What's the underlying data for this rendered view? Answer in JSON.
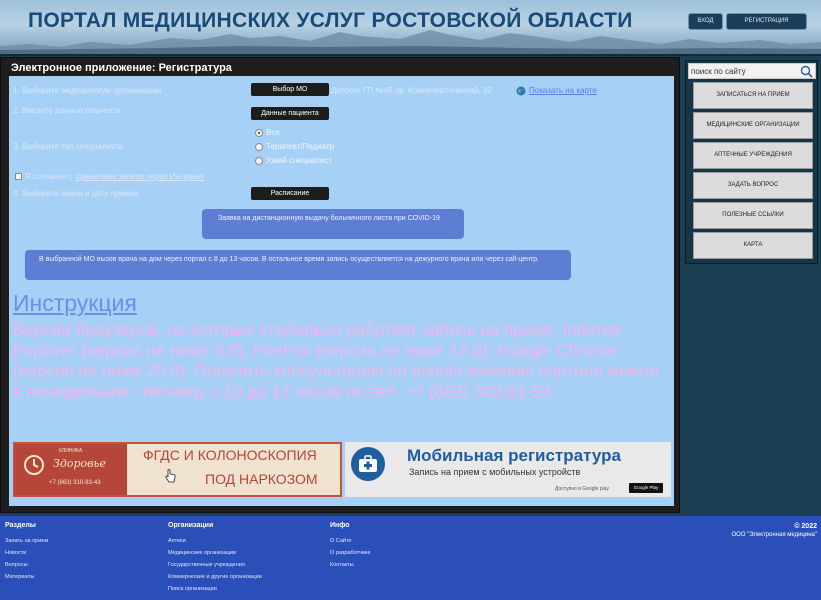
{
  "header": {
    "title": "ПОРТАЛ МЕДИЦИНСКИХ УСЛУГ РОСТОВСКОЙ ОБЛАСТИ",
    "login_label": "ВХОД",
    "register_label": "РЕГИСТРАЦИЯ"
  },
  "main": {
    "title": "Электронное приложение: Регистратура",
    "steps": {
      "s1": "1. Выберите медицинскую организацию",
      "s2": "2. Введите данные пациента",
      "s3": "3. Выберите тип специалиста",
      "s4": "4. Выберите врача и дату приема"
    },
    "buttons": {
      "select_mo": "Выбор МО",
      "patient_data": "Данные пациента",
      "schedule": "Расписание"
    },
    "mo_selected": "Детская ГП №45 пр. Коммунистический, 32",
    "show_on_map": "Показать на карте",
    "specialist_types": [
      "Все",
      "Терапевт/Педиатр",
      "Узкий специалист"
    ],
    "agree_prefix": "Я согласен с",
    "agree_link": "правилами записи через Интернет",
    "covid_text": "Заявка на дистанционную выдачу больничного листа при COVID-19",
    "info_text": "В выбранной МО вызов врача на дом через портал с 8 до 13 часов. В остальное время запись осуществляется на дежурного врача или через call-центр.",
    "instruction_title": "Инструкция",
    "instruction_text": "Версии браузеров, на которых стабильно работает запись на прием: Internet Explorer (версия не ниже 9.0), FireFox (версия не ниже 12.0), Google Chrome (версия не ниже 20.0). Получить консультацию по использованию портала можно в понедельник - пятницу с 10 до 17 часов по тел. +7 (863) 302-01-53."
  },
  "banner_clinic": {
    "logo_small": "КЛИНИКА",
    "logo_name": "Здоровье",
    "phone": "+7 (863) 310-83-43",
    "line1": "ФГДС И КОЛОНОСКОПИЯ",
    "line2": "ПОД НАРКОЗОМ"
  },
  "banner_mobile": {
    "title": "Мобильная регистратура",
    "subtitle": "Запись на прием с мобильных устройств",
    "available": "Доступно в Google play",
    "gplay": "Google Play"
  },
  "sidebar": {
    "search_placeholder": "поиск по сайту",
    "items": [
      "ЗАПИСАТЬСЯ НА ПРИЕМ",
      "МЕДИЦИНСКИЕ ОРГАНИЗАЦИИ",
      "АПТЕЧНЫЕ УЧРЕЖДЕНИЯ",
      "ЗАДАТЬ ВОПРОС",
      "ПОЛЕЗНЫЕ ССЫЛКИ",
      "КАРТА"
    ]
  },
  "footer": {
    "sections": {
      "title": "Разделы",
      "links": [
        "Запись на прием",
        "Новости",
        "Вопросы",
        "Материалы"
      ]
    },
    "orgs": {
      "title": "Организации",
      "links": [
        "Аптеки",
        "Медицинские организации",
        "Государственные учреждения",
        "Коммерческие и другие организации",
        "Поиск организации"
      ]
    },
    "info": {
      "title": "Инфо",
      "links": [
        "О Сайте",
        "О разработчике",
        "Контакты"
      ]
    },
    "copyright_year": "© 2022",
    "copyright_org": "ООО \"Электронная медицина\""
  },
  "colors": {
    "content_bg": "#a7d0f7",
    "footer_bg": "#2b4fb9",
    "instruction_text": "#f3b5ee",
    "link_blue": "#6b8ee6"
  }
}
